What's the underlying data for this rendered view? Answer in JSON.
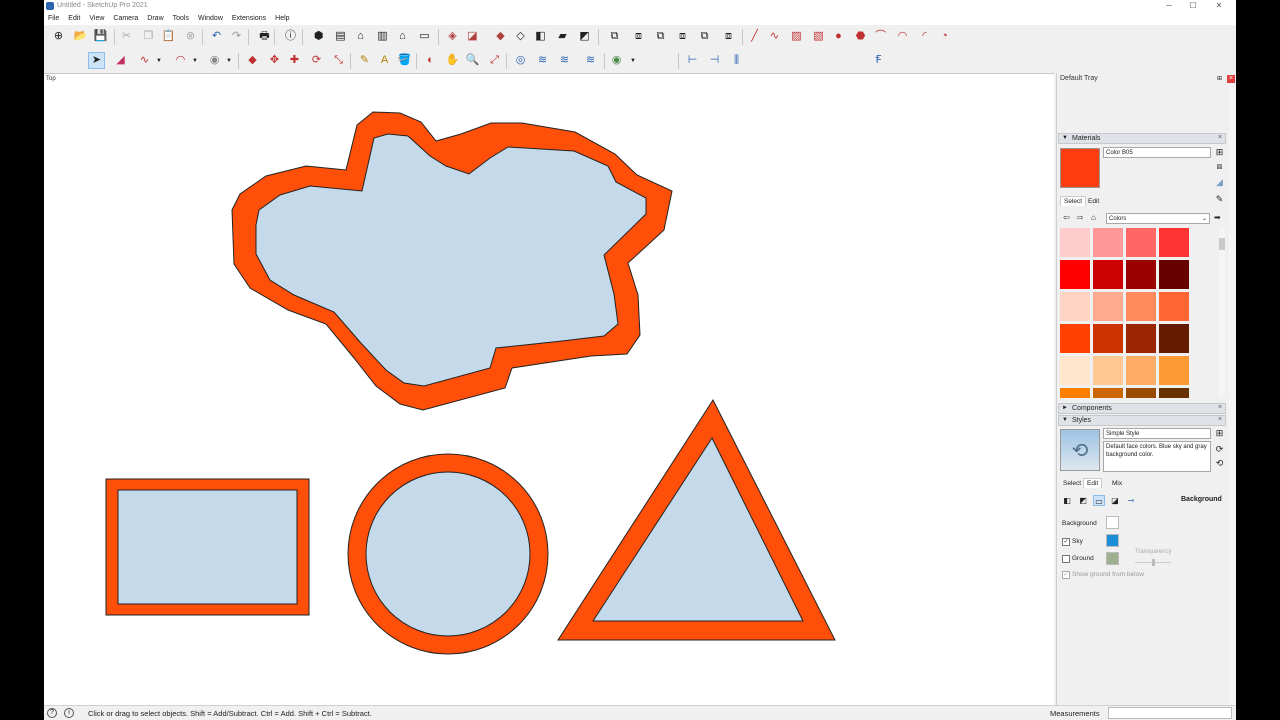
{
  "window": {
    "title": "Untitled - SketchUp Pro 2021",
    "min": "─",
    "max": "☐",
    "close": "✕"
  },
  "menu": [
    "File",
    "Edit",
    "View",
    "Camera",
    "Draw",
    "Tools",
    "Window",
    "Extensions",
    "Help"
  ],
  "viewport": {
    "scene_label": "Top"
  },
  "tray": {
    "title": "Default Tray",
    "pin": "⊞",
    "close": "×",
    "materials": {
      "header": "Materials",
      "current_color": "#ff3d0d",
      "material_name": "Color B05",
      "tabs": [
        "Select",
        "Edit"
      ],
      "library": "Colors",
      "swatches": [
        [
          "#ffcccc",
          "#ff9999",
          "#ff6666",
          "#ff3333"
        ],
        [
          "#ff0000",
          "#cc0000",
          "#990000",
          "#660000"
        ],
        [
          "#ffd4c4",
          "#ffaa8f",
          "#ff8a5c",
          "#ff6633"
        ],
        [
          "#ff4000",
          "#cc3300",
          "#992600",
          "#661a00"
        ],
        [
          "#ffe6cc",
          "#ffc794",
          "#ffad66",
          "#ff9933"
        ],
        [
          "#ff8000",
          "#cc6600",
          "#994c00",
          "#663300"
        ]
      ]
    },
    "components": {
      "header": "Components"
    },
    "styles": {
      "header": "Styles",
      "style_name": "Simple Style",
      "description": "Default face colors. Blue sky and gray background color.",
      "tabs": [
        "Select",
        "Edit",
        "Mix"
      ],
      "section": "Background",
      "background_label": "Background",
      "background_color": "#ffffff",
      "sky_label": "Sky",
      "sky_checked": true,
      "sky_color": "#1a8fd8",
      "ground_label": "Ground",
      "ground_checked": false,
      "ground_color": "#9db08f",
      "transparency_label": "Transparency",
      "show_ground_label": "Show ground from below",
      "show_ground_checked": true
    }
  },
  "status": {
    "text": "Click or drag to select objects. Shift = Add/Subtract. Ctrl = Add. Shift + Ctrl = Subtract.",
    "measurements_label": "Measurements",
    "measurements_value": ""
  },
  "colors": {
    "edge_fill": "#ff4f08",
    "face_fill": "#c4d9ea"
  }
}
